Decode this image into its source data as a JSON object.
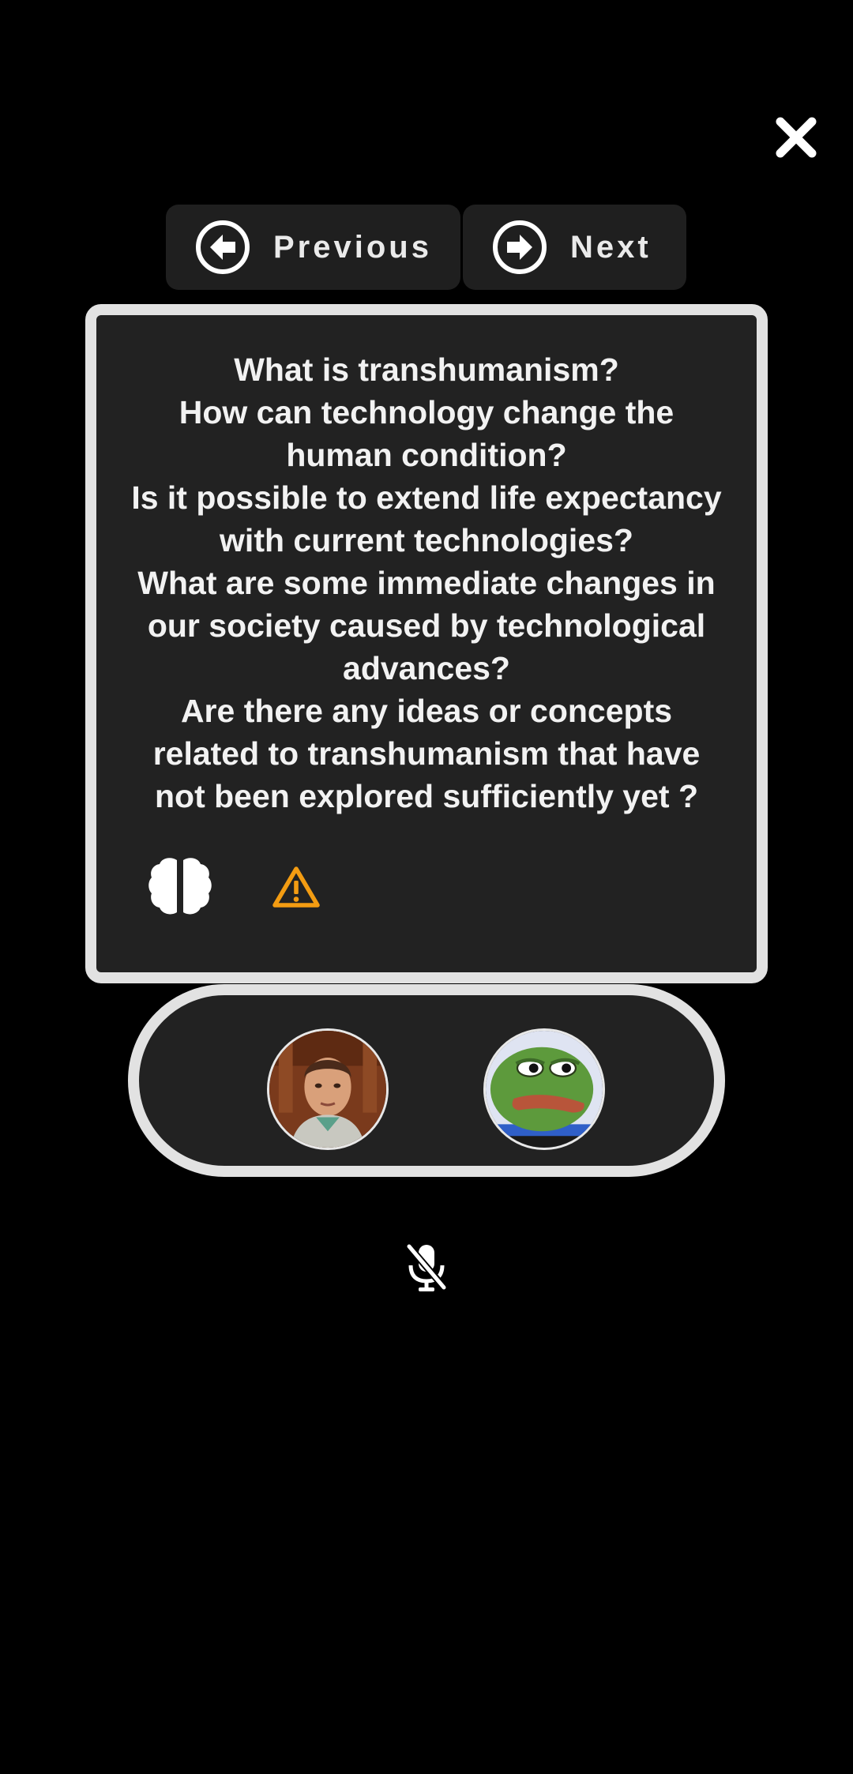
{
  "toolbar": {
    "close_icon": "close-icon"
  },
  "navigation": {
    "previous_label": "Previous",
    "previous_icon": "arrow-left-circle-icon",
    "next_label": "Next",
    "next_icon": "arrow-right-circle-icon"
  },
  "card": {
    "lines": [
      "What is transhumanism?",
      "How can technology change the human condition?",
      "Is it possible to extend life expectancy with current technologies?",
      "What are some immediate changes in our society caused by technological advances?",
      "Are there any ideas or concepts related to transhumanism that have not been explored sufficiently yet ?"
    ],
    "actions": {
      "brain_icon": "brain-icon",
      "warning_icon": "warning-triangle-icon",
      "warning_color": "#f39c12"
    }
  },
  "participants": [
    {
      "avatar": "user-photo-avatar"
    },
    {
      "avatar": "frog-avatar"
    }
  ],
  "microphone": {
    "icon": "microphone-off-icon",
    "state": "muted"
  },
  "colors": {
    "background": "#000000",
    "panel": "#222222",
    "border": "#e2e2e2",
    "button": "#1f1f1f",
    "accent_warning": "#f39c12"
  }
}
